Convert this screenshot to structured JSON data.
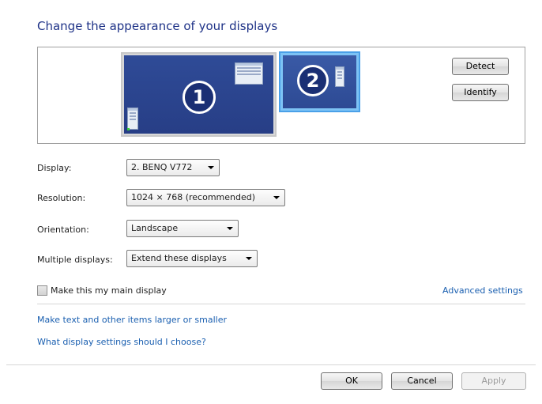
{
  "heading": "Change the appearance of your displays",
  "preview": {
    "monitor1_number": "1",
    "monitor2_number": "2",
    "detect_label": "Detect",
    "identify_label": "Identify"
  },
  "settings": {
    "display_label": "Display:",
    "display_value": "2. BENQ V772",
    "resolution_label": "Resolution:",
    "resolution_value": "1024 × 768 (recommended)",
    "orientation_label": "Orientation:",
    "orientation_value": "Landscape",
    "multiple_label": "Multiple displays:",
    "multiple_value": "Extend these displays"
  },
  "main_display_checkbox": {
    "label": "Make this my main display",
    "checked": false
  },
  "links": {
    "advanced": "Advanced settings",
    "text_size": "Make text and other items larger or smaller",
    "which_settings": "What display settings should I choose?"
  },
  "footer": {
    "ok": "OK",
    "cancel": "Cancel",
    "apply": "Apply"
  },
  "colors": {
    "heading": "#1e3287",
    "link": "#1a5fb0",
    "monitor_selected_border": "#4aa0e8"
  }
}
